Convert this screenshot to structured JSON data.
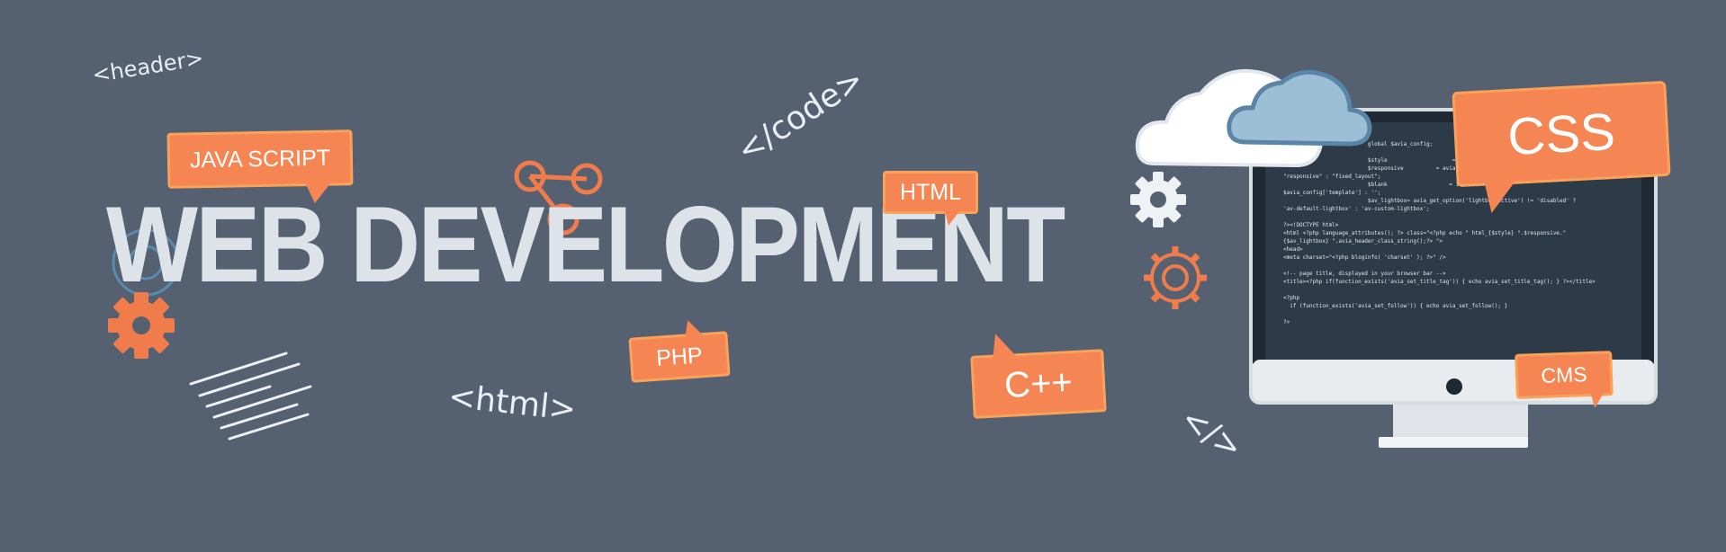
{
  "banner": {
    "title": "WEB DEVELOPMENT",
    "tags": {
      "header": "<header>",
      "code": "</code>",
      "html": "<html>",
      "slash": "</>"
    },
    "bubbles": {
      "javascript": "JAVA SCRIPT",
      "html": "HTML",
      "php": "PHP",
      "cpp": "C++",
      "css": "CSS",
      "cms": "CMS"
    },
    "screen_code": [
      "                          global $avia_config;",
      "",
      "                          $style                    = $avia",
      "                          $responsive          = avia_get_option('re",
      "\"responsive\" : \"fixed_layout\";",
      "                          $blank                   = isset($avia_co",
      "$avia_config['template'] : '';",
      "                          $av_lightbox= avia_get_option('lightbox_active') != 'disabled' ?",
      "'av-default-lightbox' : 'av-custom-lightbox';",
      "",
      "?><!DOCTYPE html>",
      "<html <?php language_attributes(); ?> class=\"<?php echo \" html_{$style} \".$responsive.\"",
      "{$av_lightbox} \".avia_header_class_string();?> \">",
      "<head>",
      "<meta charset=\"<?php bloginfo( 'charset' ); ?>\" />",
      "",
      "<!-- page title, displayed in your browser bar -->",
      "<title><?php if(function_exists('avia_set_title_tag')) { echo avia_set_title_tag(); } ?></title>",
      "",
      "<?php",
      "  if (function_exists('avia_set_follow')) { echo avia_set_follow(); }",
      "",
      "?>"
    ],
    "colors": {
      "background": "#556070",
      "accent": "#f58552",
      "title": "#dde3e8",
      "cloud_white": "#ffffff",
      "cloud_blue": "#9dbfd6",
      "monitor_screen": "#2d3a48",
      "monitor_frame": "#e6e9ec"
    },
    "icons": [
      "gear-icon",
      "cloud-icon",
      "share-nodes-icon",
      "monitor-icon",
      "code-lines-icon"
    ]
  }
}
